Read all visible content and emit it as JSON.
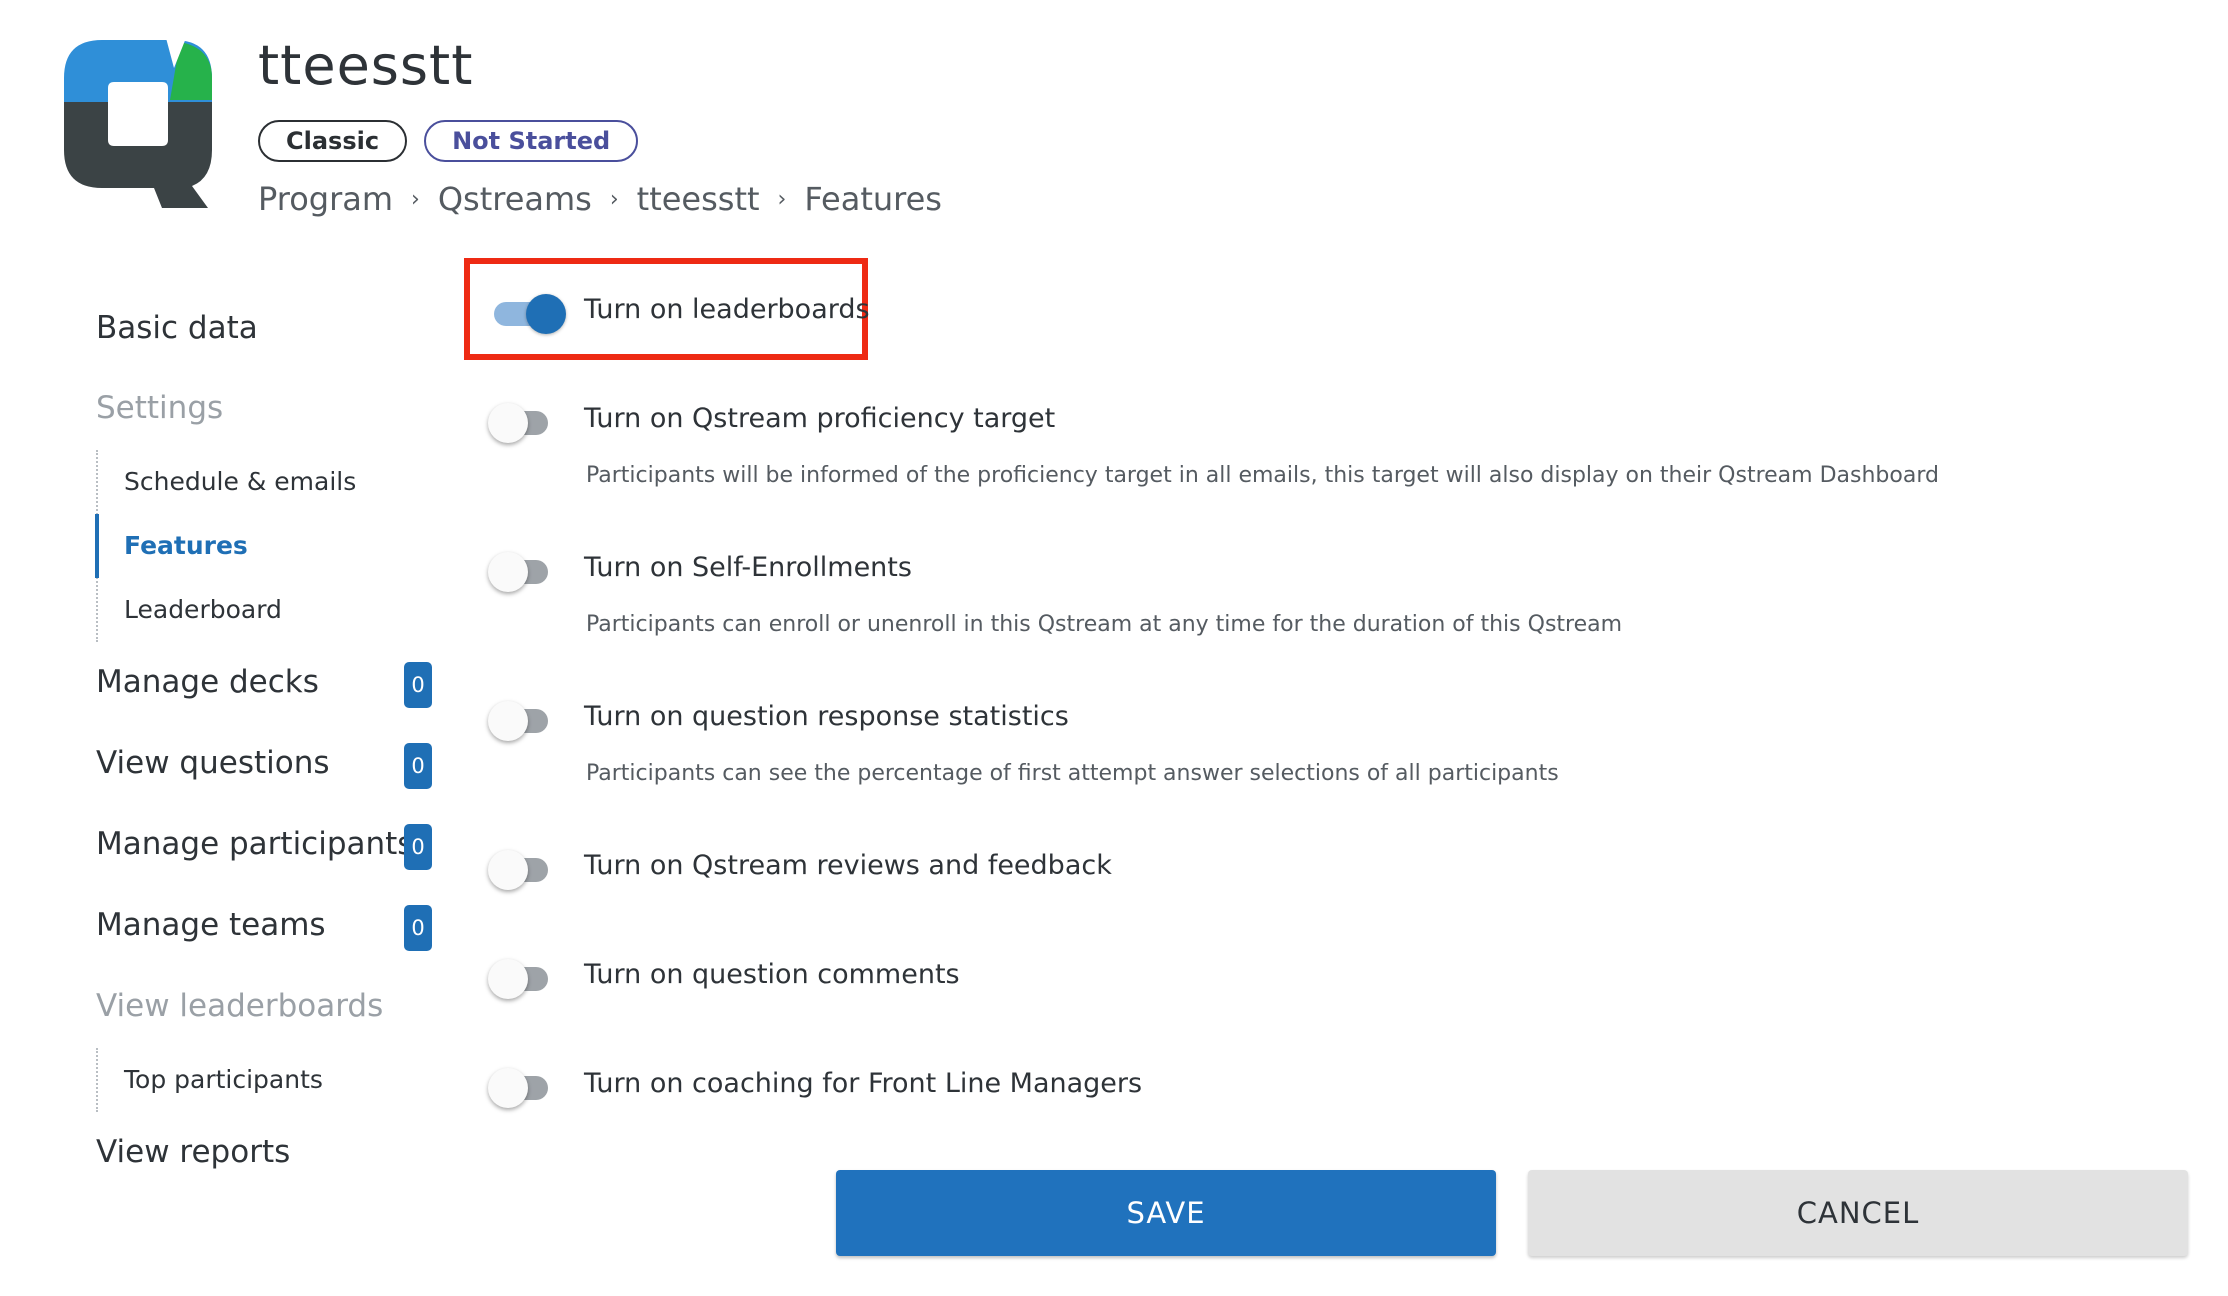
{
  "header": {
    "title": "tteesstt",
    "badges": {
      "type": "Classic",
      "status": "Not Started"
    },
    "breadcrumb": [
      "Program",
      "Qstreams",
      "tteesstt",
      "Features"
    ],
    "breadcrumb_separator": "›"
  },
  "sidebar": {
    "basic_data": "Basic data",
    "settings": {
      "label": "Settings",
      "items": [
        "Schedule & emails",
        "Features",
        "Leaderboard"
      ],
      "active": "Features"
    },
    "manage_decks": {
      "label": "Manage decks",
      "count": "0"
    },
    "view_questions": {
      "label": "View questions",
      "count": "0"
    },
    "manage_participants": {
      "label": "Manage participants",
      "count": "0"
    },
    "manage_teams": {
      "label": "Manage teams",
      "count": "0"
    },
    "view_leaderboards": {
      "label": "View leaderboards",
      "items": [
        "Top participants"
      ]
    },
    "view_reports": "View reports"
  },
  "features": [
    {
      "label": "Turn on leaderboards",
      "enabled": true,
      "description": ""
    },
    {
      "label": "Turn on Qstream proficiency target",
      "enabled": false,
      "description": "Participants will be informed of the proficiency target in all emails, this target will also display on their Qstream Dashboard"
    },
    {
      "label": "Turn on Self-Enrollments",
      "enabled": false,
      "description": "Participants can enroll or unenroll in this Qstream at any time for the duration of this Qstream"
    },
    {
      "label": "Turn on question response statistics",
      "enabled": false,
      "description": "Participants can see the percentage of first attempt answer selections of all participants"
    },
    {
      "label": "Turn on Qstream reviews and feedback",
      "enabled": false,
      "description": ""
    },
    {
      "label": "Turn on question comments",
      "enabled": false,
      "description": ""
    },
    {
      "label": "Turn on coaching for Front Line Managers",
      "enabled": false,
      "description": ""
    }
  ],
  "actions": {
    "save": "SAVE",
    "cancel": "CANCEL"
  },
  "colors": {
    "accent": "#1f6fb5",
    "highlight": "#ee2a14",
    "logo_blue": "#2f8fd8",
    "logo_green": "#26b24b",
    "logo_dark": "#3b4345"
  },
  "icons": {
    "logo": "qstream-logo-icon"
  }
}
